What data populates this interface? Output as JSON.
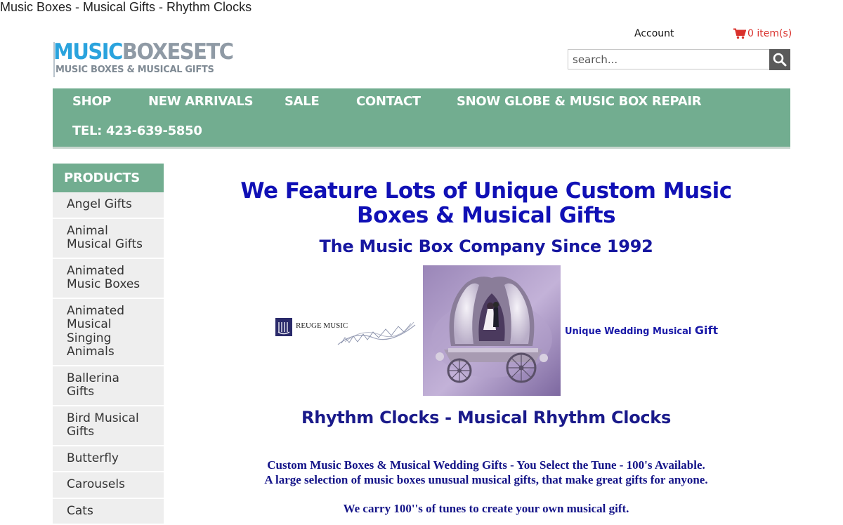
{
  "page_title": "Music Boxes - Musical Gifts - Rhythm Clocks",
  "logo": {
    "part1": "MUSIC",
    "part2": "BOXESETC",
    "tagline": "MUSIC BOXES & MUSICAL GIFTS"
  },
  "header": {
    "account": "Account",
    "cart": "0 item(s)"
  },
  "search": {
    "placeholder": "search..."
  },
  "nav": [
    "SHOP",
    "NEW ARRIVALS",
    "SALE",
    "CONTACT",
    "SNOW GLOBE & MUSIC BOX REPAIR",
    "TEL: 423-639-5850"
  ],
  "sidebar": {
    "heading": "PRODUCTS",
    "items": [
      [
        "Angel Gifts"
      ],
      [
        "Animal",
        "Musical Gifts"
      ],
      [
        "Animated",
        "Music Boxes"
      ],
      [
        "Animated",
        "Musical",
        "Singing",
        "Animals"
      ],
      [
        "Ballerina",
        "Gifts"
      ],
      [
        "Bird Musical",
        "Gifts"
      ],
      [
        "Butterfly"
      ],
      [
        "Carousels"
      ],
      [
        "Cats"
      ]
    ]
  },
  "main": {
    "heading": "We Feature Lots of Unique Custom Music Boxes & Musical Gifts",
    "subheading": "The Music Box Company Since 1992",
    "reuge_label": "REUGE MUSIC",
    "wedding_link_small": "Unique Wedding Musical ",
    "wedding_link_big": "Gift",
    "rhythm_heading": "Rhythm Clocks - Musical Rhythm Clocks",
    "paragraph1_line1": "Custom Music Boxes & Musical Wedding Gifts - You Select the Tune - 100's Available.",
    "paragraph1_line2": "A large selection of music boxes unusual musical gifts, that make great gifts for anyone.",
    "paragraph2_line1": "We carry 100''s of tunes to create your own musical gift."
  },
  "colors": {
    "nav_green": "#72ad90",
    "heading_blue": "#1010b5",
    "cart_red": "#d9302b"
  }
}
